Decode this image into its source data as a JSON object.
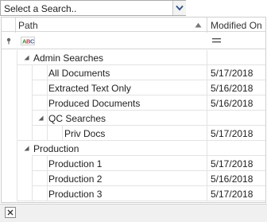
{
  "search_dropdown": {
    "value": "Select a Search.."
  },
  "grid": {
    "columns": [
      "Path",
      "Modified On"
    ],
    "rows": [
      {
        "label": "Admin Searches",
        "date": "",
        "level": 1,
        "expanded": true
      },
      {
        "label": "All Documents",
        "date": "5/17/2018",
        "level": 2
      },
      {
        "label": "Extracted Text Only",
        "date": "5/16/2018",
        "level": 2
      },
      {
        "label": "Produced Documents",
        "date": "5/16/2018",
        "level": 2
      },
      {
        "label": "QC Searches",
        "date": "",
        "level": 2,
        "expanded": true
      },
      {
        "label": "Priv Docs",
        "date": "5/17/2018",
        "level": 3
      },
      {
        "label": "Production",
        "date": "",
        "level": 1,
        "expanded": true
      },
      {
        "label": "Production 1",
        "date": "5/17/2018",
        "level": 2
      },
      {
        "label": "Production 2",
        "date": "5/16/2018",
        "level": 2
      },
      {
        "label": "Production 3",
        "date": "5/17/2018",
        "level": 2
      }
    ]
  },
  "colors": {
    "accent": "#4a6fa5",
    "border": "#d6d6d6",
    "footer_bg": "#f0f0f0"
  }
}
